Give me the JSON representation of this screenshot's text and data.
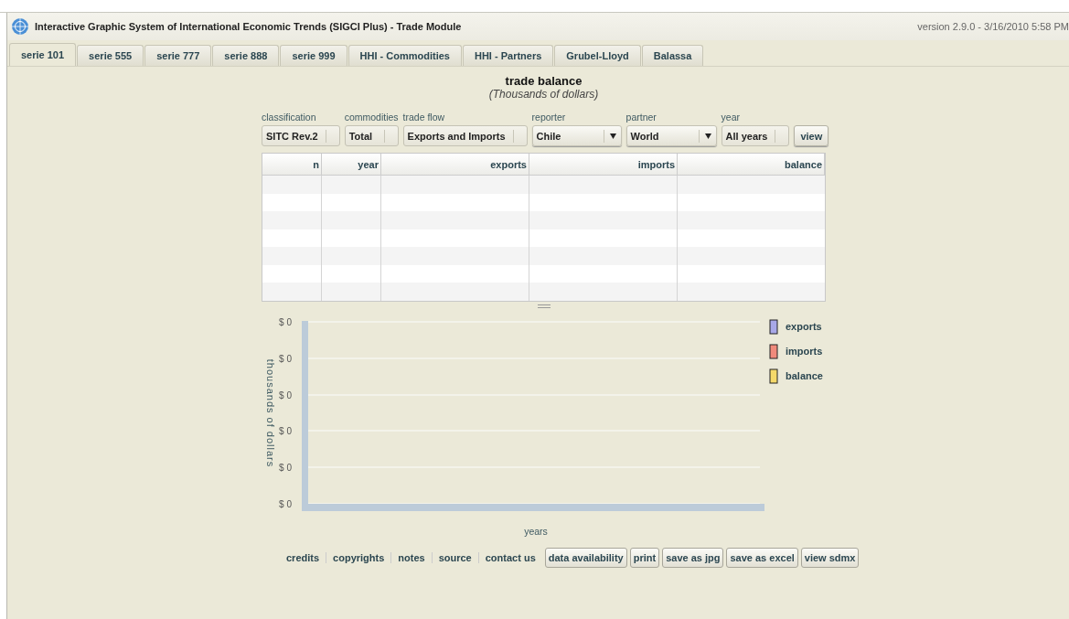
{
  "window": {
    "title": "Interactive Graphic System of International Economic Trends (SIGCI Plus) - Trade Module",
    "version": "version 2.9.0 - 3/16/2010 5:58 PM"
  },
  "tabs": [
    {
      "label": "serie 101",
      "selected": true
    },
    {
      "label": "serie 555",
      "selected": false
    },
    {
      "label": "serie 777",
      "selected": false
    },
    {
      "label": "serie 888",
      "selected": false
    },
    {
      "label": "serie 999",
      "selected": false
    },
    {
      "label": "HHI - Commodities",
      "selected": false
    },
    {
      "label": "HHI - Partners",
      "selected": false
    },
    {
      "label": "Grubel-Lloyd",
      "selected": false
    },
    {
      "label": "Balassa",
      "selected": false
    }
  ],
  "heading": {
    "title": "trade balance",
    "subtitle": "(Thousands of dollars)"
  },
  "filters": [
    {
      "label": "classification",
      "value": "SITC Rev.2",
      "kind": "static"
    },
    {
      "label": "commodities",
      "value": "Total",
      "kind": "static"
    },
    {
      "label": "trade flow",
      "value": "Exports and Imports",
      "kind": "static"
    },
    {
      "label": "reporter",
      "value": "Chile",
      "kind": "dropdown"
    },
    {
      "label": "partner",
      "value": "World",
      "kind": "dropdown"
    },
    {
      "label": "year",
      "value": "All years",
      "kind": "static"
    }
  ],
  "view_button": "view",
  "table": {
    "columns": [
      "n",
      "year",
      "exports",
      "imports",
      "balance"
    ]
  },
  "chart": {
    "ylabel": "thousands of dollars",
    "xlabel": "years",
    "yticks": [
      "$ 0",
      "$ 0",
      "$ 0",
      "$ 0",
      "$ 0",
      "$ 0"
    ],
    "legend": [
      {
        "name": "exports",
        "color": "#a8a8e8"
      },
      {
        "name": "imports",
        "color": "#f08a7c"
      },
      {
        "name": "balance",
        "color": "#f5d96a"
      }
    ]
  },
  "footer_links": [
    "credits",
    "copyrights",
    "notes",
    "source",
    "contact us"
  ],
  "footer_buttons": [
    "data availability",
    "print",
    "save as jpg",
    "save as excel",
    "view sdmx"
  ]
}
